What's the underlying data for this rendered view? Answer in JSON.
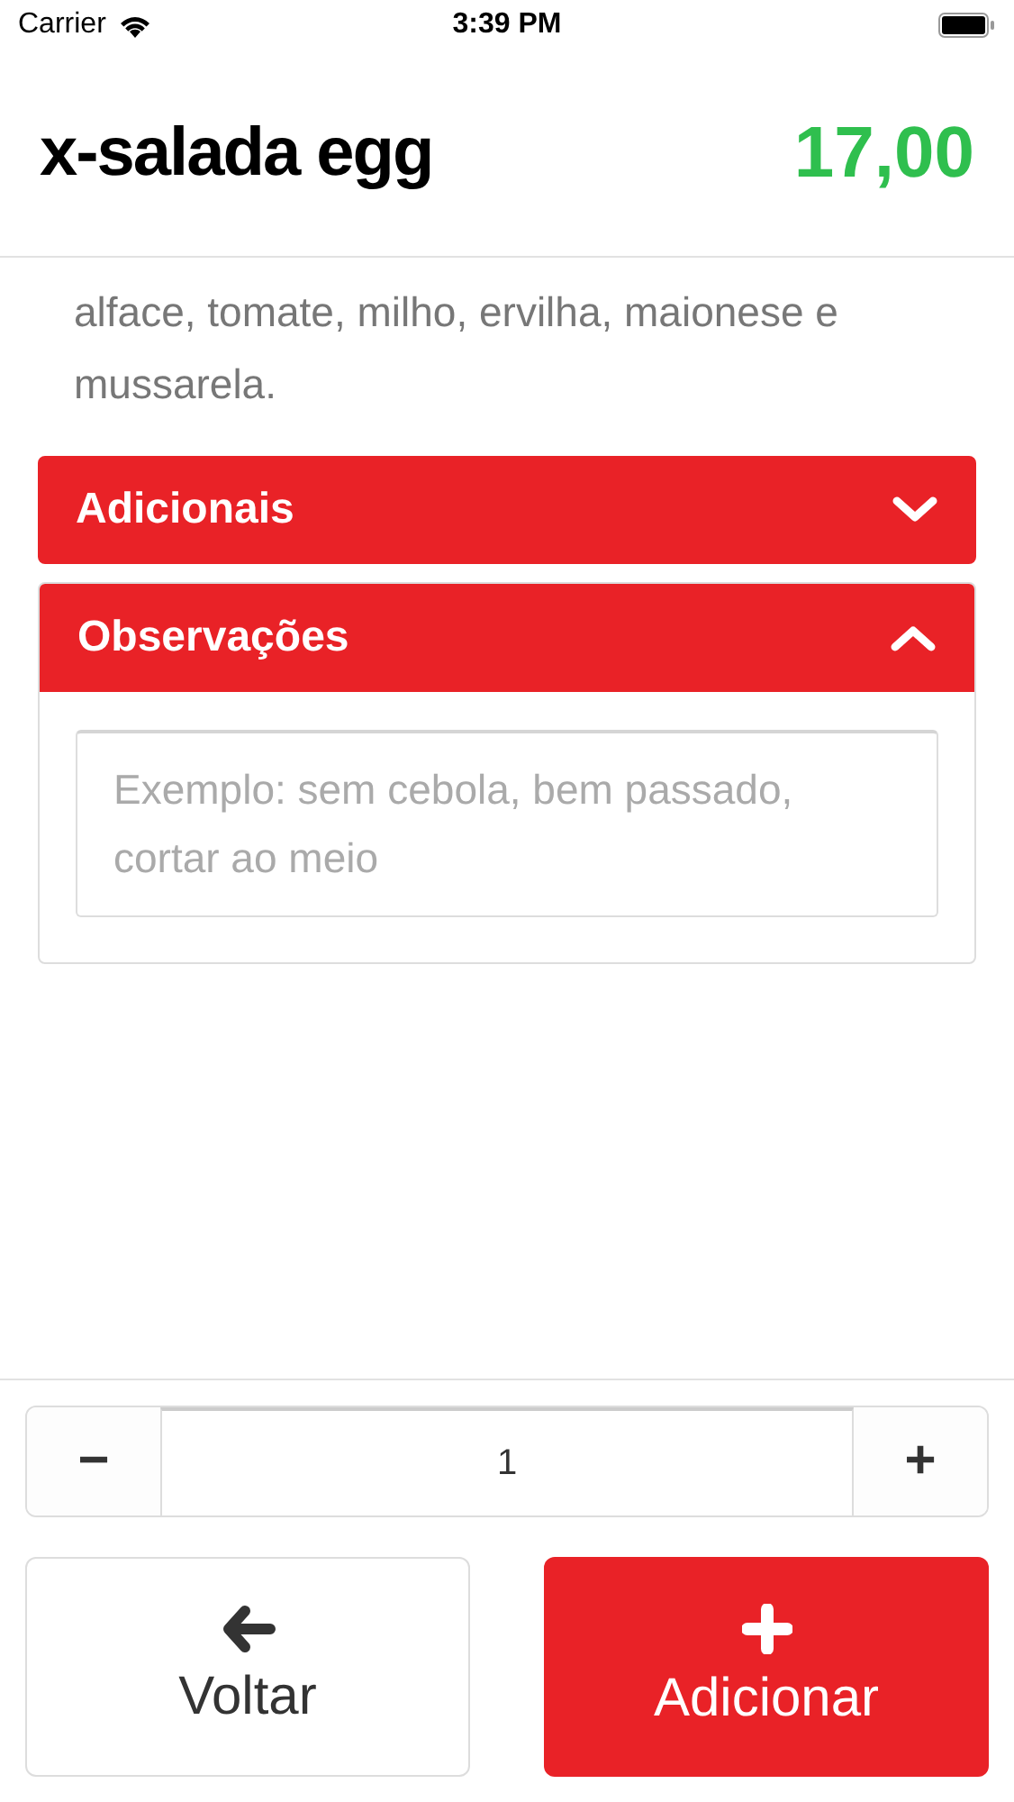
{
  "status_bar": {
    "carrier": "Carrier",
    "time": "3:39 PM"
  },
  "product": {
    "name": "x-salada egg",
    "price": "17,00",
    "description": "alface, tomate, milho, ervilha, maionese e mussarela."
  },
  "sections": [
    {
      "title": "Adicionais",
      "expanded": false
    },
    {
      "title": "Observações",
      "expanded": true,
      "placeholder": "Exemplo: sem cebola, bem passado, cortar ao meio"
    }
  ],
  "quantity": {
    "minus": "−",
    "value": "1",
    "plus": "+"
  },
  "actions": [
    {
      "kind": "back",
      "label": "Voltar"
    },
    {
      "kind": "add",
      "label": "Adicionar"
    }
  ]
}
